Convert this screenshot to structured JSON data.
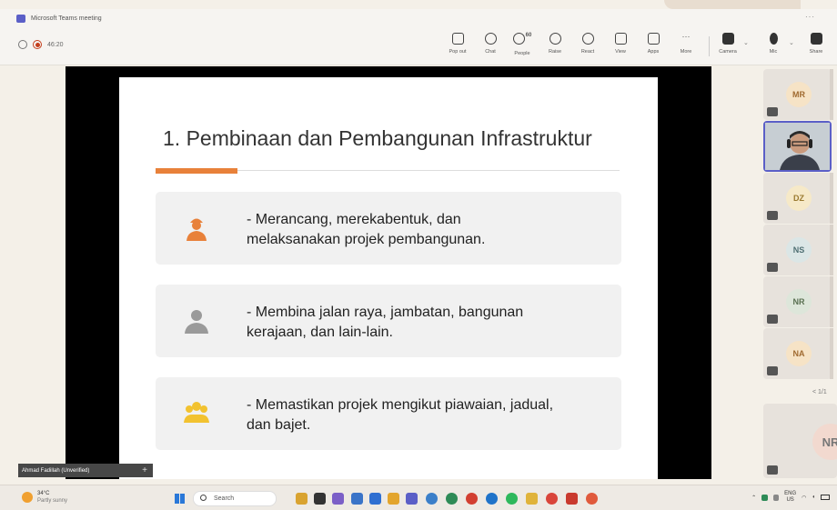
{
  "window": {
    "title": "Microsoft Teams meeting",
    "more": "···"
  },
  "meeting": {
    "timer": "46:20"
  },
  "toolbar": {
    "buttons": [
      {
        "label": "Pop out",
        "icon": "popout-icon"
      },
      {
        "label": "Chat",
        "icon": "chat-icon"
      },
      {
        "label": "People",
        "icon": "people-icon",
        "badge": "60"
      },
      {
        "label": "Raise",
        "icon": "raise-hand-icon"
      },
      {
        "label": "React",
        "icon": "react-icon"
      },
      {
        "label": "View",
        "icon": "view-icon"
      },
      {
        "label": "Apps",
        "icon": "apps-icon"
      },
      {
        "label": "More",
        "icon": "more-icon"
      },
      {
        "label": "Camera",
        "icon": "camera-off-icon"
      },
      {
        "label": "Mic",
        "icon": "mic-off-icon"
      },
      {
        "label": "Share",
        "icon": "share-icon"
      }
    ]
  },
  "slide": {
    "title": "1. Pembinaan dan Pembangunan Infrastruktur",
    "accent_color": "#e8813a",
    "items": [
      {
        "icon": "engineer-icon",
        "icon_color": "#e8813a",
        "line1": "- Merancang, merekabentuk, dan",
        "line2": "melaksanakan projek pembangunan."
      },
      {
        "icon": "worker-icon",
        "icon_color": "#9a9a9a",
        "line1": "- Membina jalan raya, jambatan, bangunan",
        "line2": "kerajaan, dan lain-lain."
      },
      {
        "icon": "team-icon",
        "icon_color": "#f2c230",
        "line1": "- Memastikan projek mengikut piawaian, jadual,",
        "line2": "dan bajet."
      }
    ]
  },
  "participants": [
    {
      "initials": "MR",
      "color": "#f6e3c6"
    },
    {
      "initials": "",
      "video": true
    },
    {
      "initials": "DZ",
      "color": "#f6e9c8"
    },
    {
      "initials": "NS",
      "color": "#dbe6e6"
    },
    {
      "initials": "NR",
      "color": "#dde6da"
    },
    {
      "initials": "NA",
      "color": "#f6e3c6"
    }
  ],
  "pager": "< 1/1",
  "big_participant": {
    "initials": "NR"
  },
  "presenter": {
    "name": "Ahmad Fadillah (Unverified)"
  },
  "taskbar": {
    "weather_temp": "34°C",
    "weather_desc": "Partly sunny",
    "search_placeholder": "Search",
    "lang_top": "ENG",
    "lang_bottom": "US"
  }
}
